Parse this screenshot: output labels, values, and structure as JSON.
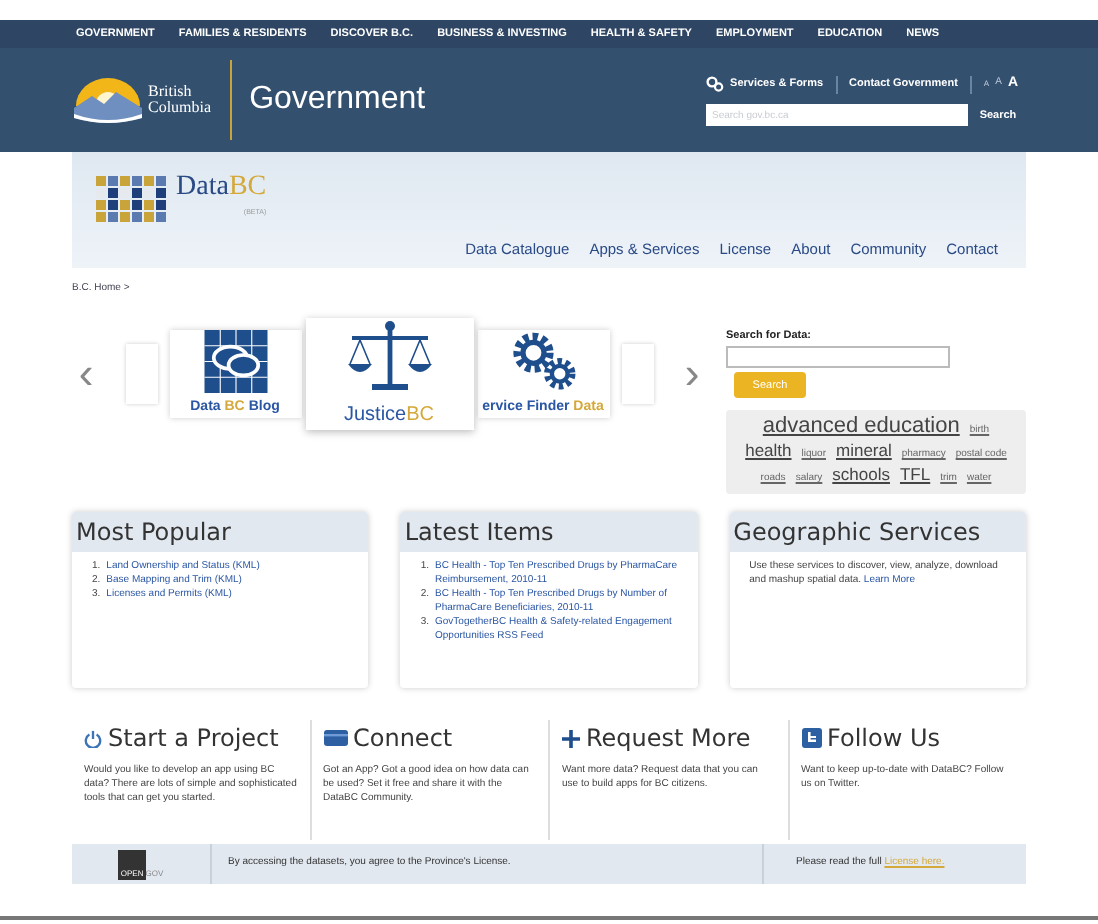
{
  "top_nav": [
    "GOVERNMENT",
    "FAMILIES & RESIDENTS",
    "DISCOVER B.C.",
    "BUSINESS & INVESTING",
    "HEALTH & SAFETY",
    "EMPLOYMENT",
    "EDUCATION",
    "NEWS"
  ],
  "header": {
    "logo_lines": [
      "British",
      "Columbia"
    ],
    "title": "Government",
    "links": [
      "Services & Forms",
      "Contact Government"
    ],
    "text_sizes": [
      "A",
      "A",
      "A"
    ],
    "search_placeholder": "Search gov.bc.ca",
    "search_button": "Search"
  },
  "site": {
    "logo_main": "Data",
    "logo_accent": "BC",
    "logo_sub": "(BETA)",
    "nav": [
      "Data Catalogue",
      "Apps & Services",
      "License",
      "About",
      "Community",
      "Contact"
    ]
  },
  "breadcrumb": "B.C. Home >",
  "carousel": {
    "prev": "‹",
    "next": "›",
    "cards": [
      {
        "kind": "blog",
        "label": "Data ",
        "accent": "BC",
        "label_end": " Blog",
        "selected": false
      },
      {
        "kind": "justice",
        "label": "Justice",
        "accent": "BC",
        "selected": true
      },
      {
        "kind": "gears",
        "label": "ervice Finder ",
        "accent": "Data",
        "selected": false
      }
    ]
  },
  "data_search": {
    "label": "Search for Data:",
    "button": "Search",
    "tags": [
      {
        "text": "advanced education",
        "kind": "large"
      },
      {
        "text": "birth",
        "kind": "small"
      },
      {
        "text": "health",
        "kind": "medium"
      },
      {
        "text": "liquor",
        "kind": "small"
      },
      {
        "text": "mineral",
        "kind": "medium"
      },
      {
        "text": "pharmacy",
        "kind": "small"
      },
      {
        "text": "postal code",
        "kind": "small"
      },
      {
        "text": "roads",
        "kind": "small"
      },
      {
        "text": "salary",
        "kind": "small"
      },
      {
        "text": "schools",
        "kind": "medium"
      },
      {
        "text": "TFL",
        "kind": "medium"
      },
      {
        "text": "trim",
        "kind": "small"
      },
      {
        "text": "water",
        "kind": "small"
      }
    ]
  },
  "panels": [
    {
      "title": "Most Popular",
      "kind": "list",
      "items": [
        {
          "number": "1.",
          "text": "Land Ownership and Status (KML)"
        },
        {
          "number": "2.",
          "text": "Base Mapping and Trim (KML)"
        },
        {
          "number": "3.",
          "text": "Licenses and Permits (KML)"
        }
      ]
    },
    {
      "title": "Latest Items",
      "kind": "list",
      "items": [
        {
          "number": "1.",
          "text": "BC Health - Top Ten Prescribed Drugs by PharmaCare Reimbursement, 2010-11"
        },
        {
          "number": "2.",
          "text": "BC Health - Top Ten Prescribed Drugs by Number of PharmaCare Beneficiaries, 2010-11"
        },
        {
          "number": "3.",
          "text": "GovTogetherBC Health & Safety-related Engagement Opportunities RSS Feed"
        }
      ]
    },
    {
      "title": "Geographic Services",
      "kind": "text",
      "text": "Use these services to discover, view, analyze, download and mashup spatial data.",
      "link": "Learn More"
    }
  ],
  "features": [
    {
      "kind": "power",
      "title": "Start a Project",
      "text": "Would you like to develop an app using BC data? There are lots of simple and sophisticated tools that can get you started."
    },
    {
      "kind": "card",
      "title": "Connect",
      "text": "Got an App? Got a good idea on how data can be used? Set it free and share it with the DataBC Community."
    },
    {
      "kind": "plus",
      "title": "Request More",
      "text": "Want more data? Request data that you can use to build apps for BC citizens."
    },
    {
      "kind": "twitter",
      "title": "Follow Us",
      "text": "Want to keep up-to-date with DataBC? Follow us on Twitter."
    }
  ],
  "footer": {
    "logo": [
      "OPEN",
      "GOV"
    ],
    "notice": "By accessing the datasets, you agree to the Province's License.",
    "read": "Please read the full ",
    "link": "License here."
  }
}
